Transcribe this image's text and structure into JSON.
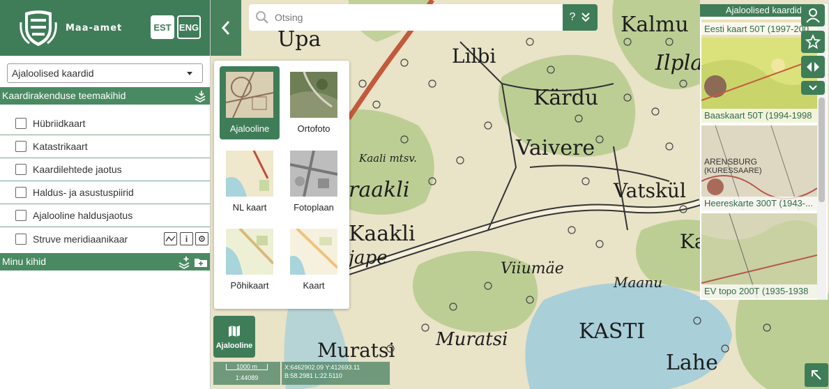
{
  "brand": {
    "name": "Maa-amet"
  },
  "languages": [
    {
      "code": "EST",
      "active": true
    },
    {
      "code": "ENG",
      "active": false
    }
  ],
  "map_type_select": {
    "value": "Ajaloolised kaardid"
  },
  "theme_layers": {
    "heading": "Kaardirakenduse teemakihid",
    "items": [
      {
        "label": "Hübriidkaart",
        "checked": false
      },
      {
        "label": "Katastrikaart",
        "checked": false
      },
      {
        "label": "Kaardilehtede jaotus",
        "checked": false
      },
      {
        "label": "Haldus- ja asustuspiirid",
        "checked": false
      },
      {
        "label": "Ajalooline haldusjaotus",
        "checked": false
      },
      {
        "label": "Struve meridiaanikaar",
        "checked": false
      }
    ],
    "struve_tools": [
      "graph-icon",
      "i",
      "gear-icon"
    ]
  },
  "my_layers": {
    "heading": "Minu kihid"
  },
  "search": {
    "placeholder": "Otsing",
    "help": "?"
  },
  "basemaps": {
    "items": [
      {
        "label": "Ajalooline",
        "active": true
      },
      {
        "label": "Ortofoto",
        "active": false
      },
      {
        "label": "NL kaart",
        "active": false
      },
      {
        "label": "Fotoplaan",
        "active": false
      },
      {
        "label": "Põhikaart",
        "active": false
      },
      {
        "label": "Kaart",
        "active": false
      }
    ],
    "current": "Ajalooline"
  },
  "scale": {
    "bar": "1000 m",
    "ratio": "1:44089"
  },
  "coords": {
    "xy": "X:6462902.09 Y:412693.11",
    "bl": "B:58.2981 L:22.5110"
  },
  "historical_maps": {
    "title": "Ajaloolised kaardid",
    "items": [
      {
        "label": "Eesti kaart 50T (1997-200"
      },
      {
        "label": "Baaskaart 50T (1994-1998"
      },
      {
        "label": "Heereskarte 300T (1943-..."
      },
      {
        "label": "EV topo 200T (1935-1938"
      }
    ],
    "thumb_text": {
      "arensburg": "ARENSBURG",
      "kuressaare": "(KURESSAARE)"
    }
  },
  "map_labels": [
    "Upa",
    "Lilbi",
    "Kalmu",
    "Ilpla",
    "Kärdu",
    "Vaivere",
    "Vatskül",
    "Kaali mtsv.",
    "raakli",
    "Kaakli",
    "jape",
    "Viiumäe",
    "Maanu",
    "KASTI",
    "Muratsi",
    "Muratsi",
    "Lahe",
    "Ka"
  ],
  "colors": {
    "brand_green": "#3f7d58",
    "map_paper": "#eae4c9",
    "map_forest": "#b6c98e",
    "map_water": "#a9cfd9"
  }
}
